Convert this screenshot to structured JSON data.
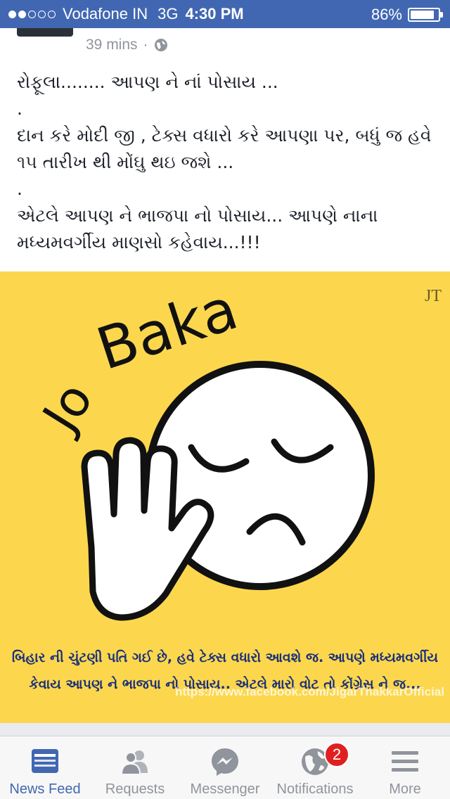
{
  "status_bar": {
    "carrier": "Vodafone IN",
    "network": "3G",
    "time": "4:30 PM",
    "battery": "86%",
    "battery_level": 0.86
  },
  "post": {
    "timestamp": "39 mins",
    "separator": "·",
    "privacy_icon": "globe-icon",
    "text": "રોફૂલા........ આપણ ને નાં પોસાય ...\n.\nદાન કરે મોદી જી , ટેક્સ વધારો કરે આપણા પર, બધું જ હવે ૧૫ તારીખ થી મોંઘુ થઇ જશે ...\n.\nએટલે આપણ ને ભાજપા નો પોસાય... આપણે નાના મધ્યમવર્ગીય માણસો કહેવાય...!!!"
  },
  "image": {
    "logo_text": "JT",
    "headline": "Jo Baka",
    "caption_line1": "બિહાર ની ચુંટણી પતિ ગઈ છે, હવે ટેક્સ વધારો આવશે જ. આપણે મધ્યમવર્ગીય",
    "caption_line2": "કેવાય આપણ ને ભાજપા નો પોસાય.. એટલે મારો વોટ તો કોંગ્રેસ ને જ...",
    "watermark": "https://www.facebook.com/JigarThakkarOfficial",
    "background_color": "#fcd74e"
  },
  "tabbar": {
    "tabs": [
      {
        "label": "News Feed",
        "icon": "news-feed-icon",
        "active": true
      },
      {
        "label": "Requests",
        "icon": "friend-requests-icon",
        "active": false
      },
      {
        "label": "Messenger",
        "icon": "messenger-icon",
        "active": false
      },
      {
        "label": "Notifications",
        "icon": "globe-notifications-icon",
        "active": false,
        "badge": "2"
      },
      {
        "label": "More",
        "icon": "hamburger-menu-icon",
        "active": false
      }
    ],
    "active_color": "#4267b2",
    "inactive_color": "#90949c"
  }
}
